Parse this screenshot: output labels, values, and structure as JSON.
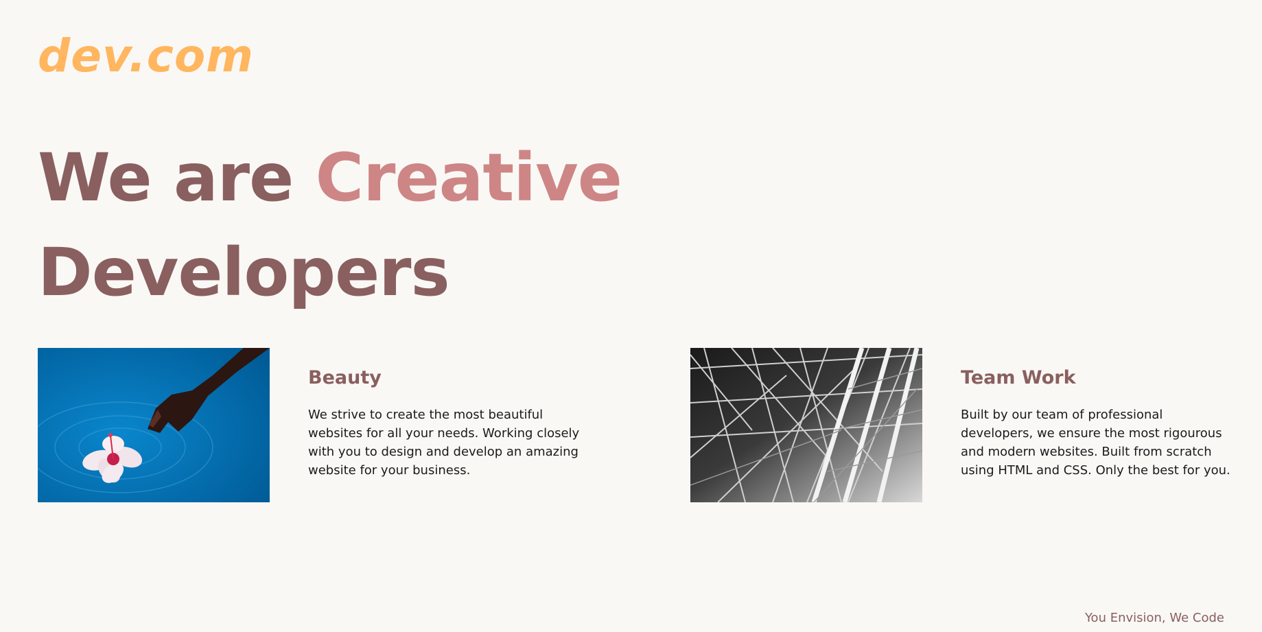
{
  "logo": {
    "text": "dev.com"
  },
  "hero": {
    "line1_prefix": "We are ",
    "line1_accent": "Creative",
    "line2": "Developers"
  },
  "features": [
    {
      "title": "Beauty",
      "body": "We strive to create the most beautiful websites for all your needs. Working closely with you to design and develop an amazing website for your business.",
      "image_icon": "hand-flower-water-photo"
    },
    {
      "title": "Team Work",
      "body": "Built by our team of professional developers, we ensure the most rigourous and modern websites. Built from scratch using HTML and CSS. Only the best for you.",
      "image_icon": "steel-structure-photo"
    }
  ],
  "footer": {
    "tagline": "You Envision, We Code"
  },
  "colors": {
    "background": "#f9f8f5",
    "logo": "#ffb65f",
    "primary_text": "#8a5f5f",
    "accent": "#cd8685"
  }
}
